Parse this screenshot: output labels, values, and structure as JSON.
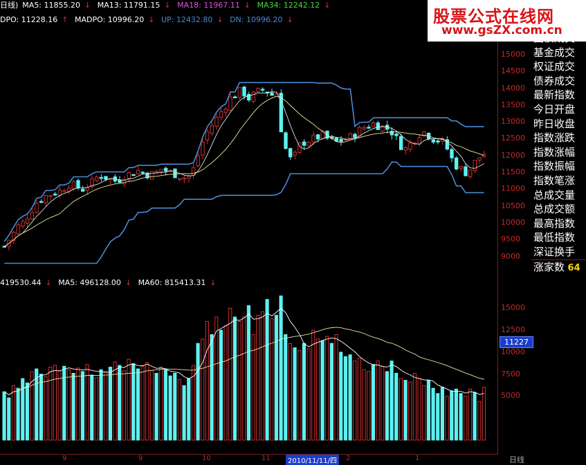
{
  "price_header": {
    "mode": "日线)",
    "ma5": "MA5: 11855.20",
    "ma13": "MA13: 11791.15",
    "ma18": "MA18: 11967.11",
    "ma34": "MA34: 12242.12",
    "dpo": "DPO: 11228.16",
    "madpo": "MADPO: 10996.20",
    "up": "UP: 12432.80",
    "dn": "DN: 10996.20"
  },
  "vol_header": {
    "vol": "419530.44",
    "ma5": "MA5: 496128.00",
    "ma60": "MA60: 815413.31"
  },
  "colors": {
    "rise": "#d03030",
    "fall": "#5ff0f0",
    "band": "#4a8ad4",
    "ma": "#ffffff",
    "ma_slow": "#e8e8a0",
    "axis": "#c82828"
  },
  "price_ticks": [
    "15000",
    "14500",
    "14000",
    "13500",
    "13000",
    "12500",
    "12000",
    "11500",
    "11000",
    "10500",
    "10000",
    "9500",
    "9000"
  ],
  "vol_ticks": [
    "15000",
    "12500",
    "10000",
    "7500",
    "5000"
  ],
  "current_vol": "11227",
  "sidebar": {
    "items": [
      "国债成交",
      "基金成交",
      "权证成交",
      "债券成交",
      "最新指数",
      "今日开盘",
      "昨日收盘",
      "指数涨跌",
      "指数涨幅",
      "指数振幅",
      "指数笔涨",
      "总成交量",
      "总成交额",
      "最高指数",
      "最低指数",
      "深证换手",
      "涨家数"
    ],
    "partial_value": "64"
  },
  "watermark": {
    "title": "股票公式在线网",
    "url": "www.gsZX.com.cn"
  },
  "bottom": {
    "months": [
      "9",
      "9",
      "10",
      "11",
      "2",
      "1"
    ],
    "date": "2010/11/11/四",
    "period": "日线"
  },
  "chart_data": [
    {
      "type": "candlestick",
      "ylim": [
        8500,
        15800
      ],
      "trend": [
        9300,
        9500,
        9700,
        9900,
        10000,
        10200,
        10400,
        10600,
        10700,
        10800,
        10850,
        10900,
        10950,
        11050,
        11150,
        11100,
        11050,
        11000,
        11100,
        11200,
        11350,
        11400,
        11350,
        11300,
        11250,
        11300,
        11400,
        11450,
        11500,
        11550,
        11500,
        11450,
        11450,
        11500,
        11600,
        11550,
        11500,
        11450,
        11400,
        11350,
        11400,
        11600,
        12000,
        12400,
        12700,
        12900,
        13100,
        13300,
        13500,
        13700,
        13800,
        13900,
        13850,
        13700,
        13800,
        13900,
        13950,
        13900,
        13800,
        13850,
        12800,
        12200,
        11900,
        12000,
        12300,
        12400,
        12450,
        12500,
        12550,
        12600,
        12500,
        12450,
        12400,
        12450,
        12500,
        12550,
        12650,
        12750,
        12850,
        12900,
        12950,
        12900,
        12850,
        12800,
        12700,
        12500,
        12300,
        12200,
        12350,
        12500,
        12650,
        12700,
        12600,
        12500,
        12450,
        12400,
        12200,
        11900,
        11700,
        11600,
        11500,
        11600,
        11800,
        11950,
        12050
      ]
    },
    {
      "type": "bar",
      "ylim": [
        0,
        17000
      ],
      "values": [
        5500,
        4800,
        6200,
        5900,
        7000,
        6500,
        7800,
        8100,
        7500,
        7200,
        8300,
        8500,
        7900,
        8400,
        8000,
        7600,
        8200,
        7800,
        8600,
        7400,
        7100,
        8000,
        7700,
        8300,
        8900,
        8500,
        7900,
        9200,
        8700,
        8100,
        8400,
        8800,
        7900,
        7600,
        8300,
        8000,
        7300,
        7600,
        6900,
        6200,
        7000,
        8500,
        11000,
        11500,
        13500,
        12000,
        14000,
        12500,
        13000,
        15000,
        14000,
        13500,
        14000,
        15300,
        12000,
        14200,
        14600,
        16000,
        13800,
        14200,
        16400,
        12000,
        11000,
        10500,
        10200,
        11000,
        10400,
        12500,
        11500,
        11300,
        11800,
        11000,
        12000,
        10000,
        9500,
        9700,
        9000,
        9300,
        8000,
        7800,
        8600,
        9000,
        8400,
        7800,
        9000,
        7600,
        7000,
        6800,
        6600,
        7600,
        7000,
        6200,
        6800,
        5900,
        5300,
        6000,
        5000,
        5600,
        5800,
        5300,
        5000,
        5800,
        5400,
        4400,
        6000
      ]
    }
  ]
}
